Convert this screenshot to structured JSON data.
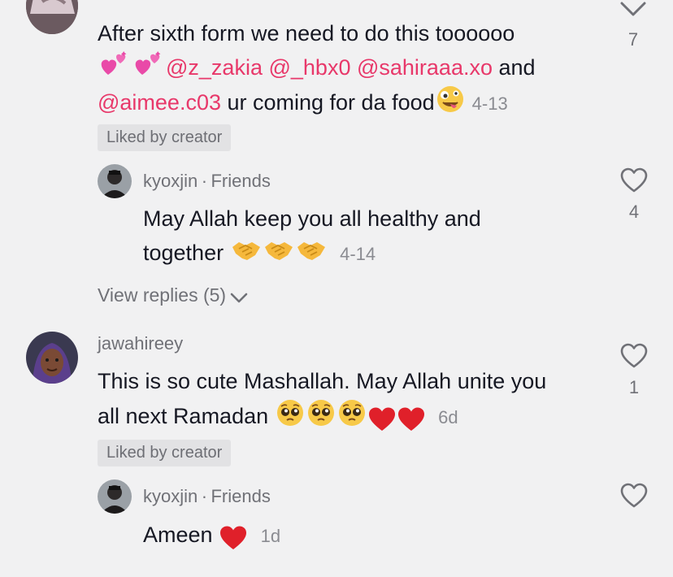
{
  "comments": [
    {
      "line1": "After sixth form we need to do this toooooo",
      "line2_mentions": [
        "@z_zakia",
        "@_hbx0",
        "@sahiraaa.xo"
      ],
      "line2_tail": " and",
      "line3_mention": "@aimee.c03",
      "line3_text": " ur coming for da food",
      "date": "4-13",
      "badge": "Liked by creator",
      "like_count": "7"
    },
    {
      "username": "kyoxjin",
      "friends": "Friends",
      "line1": "May Allah keep you all healthy and",
      "line2": "together",
      "date": "4-14",
      "like_count": "4",
      "view_replies": "View replies (5)"
    },
    {
      "username": "jawahireey",
      "line1": "This is so cute Mashallah. May Allah unite you",
      "line2": "all next Ramadan",
      "date": "6d",
      "badge": "Liked by creator",
      "like_count": "1"
    },
    {
      "username": "kyoxjin",
      "friends": "Friends",
      "text": "Ameen",
      "date": "1d"
    }
  ],
  "separator": "·",
  "colors": {
    "background": "#f1f1f2",
    "mention": "#e8386a",
    "secondary_text": "#707177",
    "heart_emoji": "#e0202a"
  },
  "icons": [
    "heart-outline-icon",
    "chevron-down-icon",
    "pleading-face-emoji",
    "red-heart-emoji",
    "handshake-emoji",
    "zany-face-emoji",
    "two-hearts-emoji"
  ]
}
